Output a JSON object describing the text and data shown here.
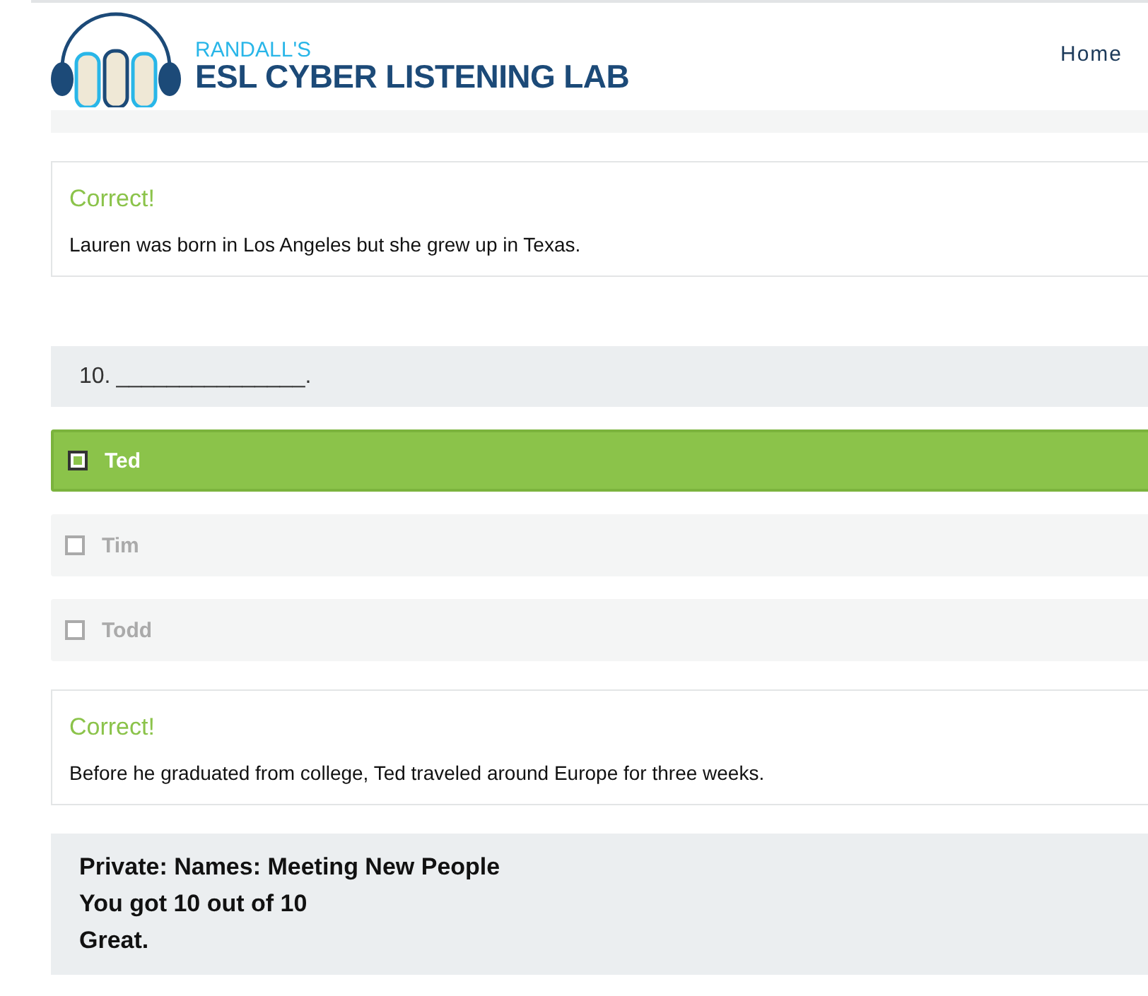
{
  "header": {
    "logo_top": "RANDALL'S",
    "logo_bottom": "ESL CYBER LISTENING LAB",
    "nav": [
      "Home"
    ]
  },
  "feedback_1": {
    "title": "Correct!",
    "text": "Lauren was born in Los Angeles but she grew up in Texas."
  },
  "question": {
    "number": "10.",
    "blank": "_______________."
  },
  "options": [
    {
      "label": "Ted",
      "selected": true
    },
    {
      "label": "Tim",
      "selected": false
    },
    {
      "label": "Todd",
      "selected": false
    }
  ],
  "feedback_2": {
    "title": "Correct!",
    "text": "Before he graduated from college, Ted traveled around Europe for three weeks."
  },
  "result": {
    "title": "Private: Names: Meeting New People",
    "score": "You got 10 out of 10",
    "comment": "Great."
  }
}
